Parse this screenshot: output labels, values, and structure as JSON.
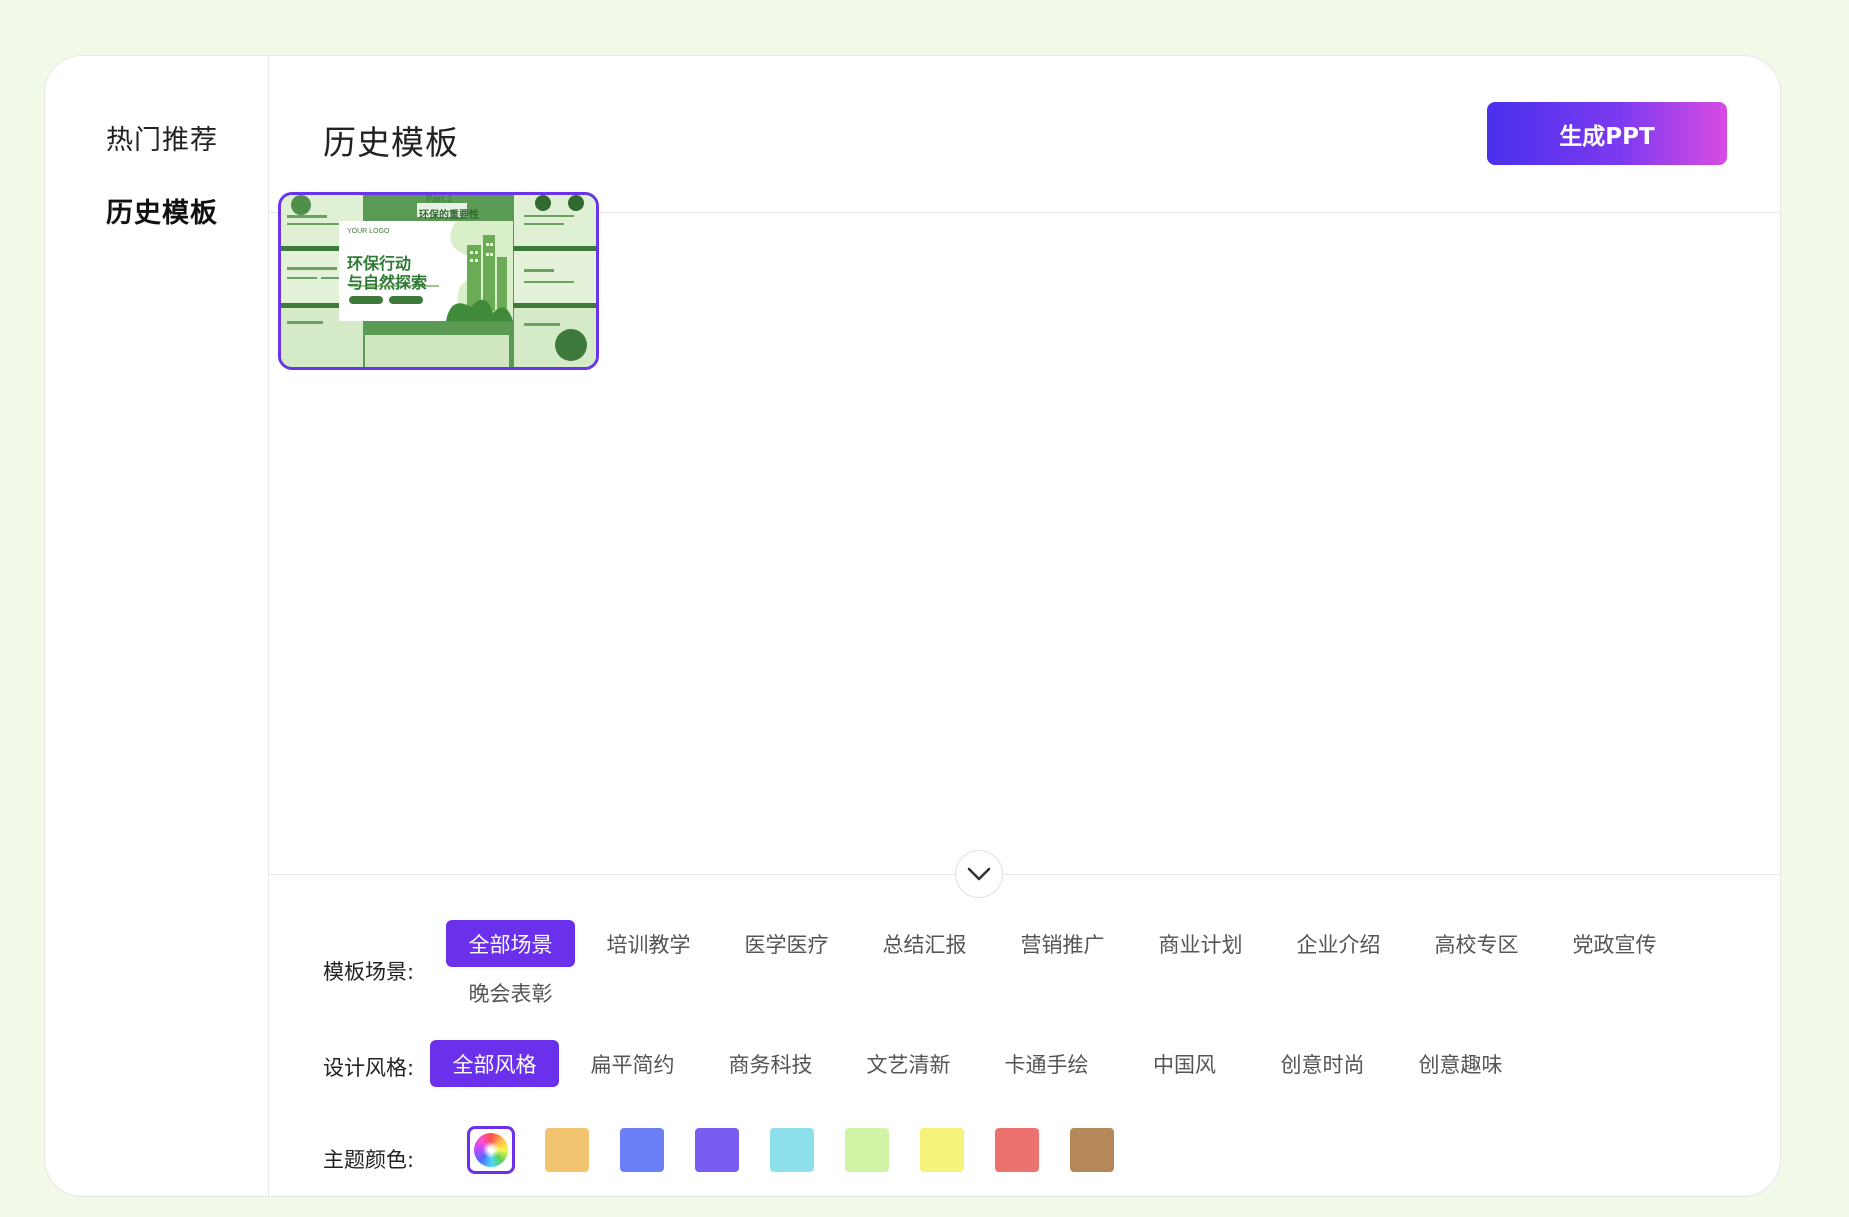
{
  "sidebar": {
    "items": [
      {
        "label": "热门推荐",
        "active": false
      },
      {
        "label": "历史模板",
        "active": true
      }
    ]
  },
  "header": {
    "title": "历史模板",
    "generate_button": "生成PPT"
  },
  "thumbnail": {
    "part_label": "Part 1",
    "section_title": "环保的重要性",
    "logo_text": "YOUR LOGO",
    "title_line1": "环保行动",
    "title_line2": "与自然探索"
  },
  "filters": {
    "scene": {
      "label": "模板场景:",
      "options": [
        "全部场景",
        "培训教学",
        "医学医疗",
        "总结汇报",
        "营销推广",
        "商业计划",
        "企业介绍",
        "高校专区",
        "党政宣传",
        "晚会表彰"
      ],
      "selected": "全部场景"
    },
    "style": {
      "label": "设计风格:",
      "options": [
        "全部风格",
        "扁平简约",
        "商务科技",
        "文艺清新",
        "卡通手绘",
        "中国风",
        "创意时尚",
        "创意趣味"
      ],
      "selected": "全部风格"
    },
    "color": {
      "label": "主题颜色:",
      "selected": "all",
      "swatches": [
        "#f2c46f",
        "#6c80f6",
        "#7a5cf0",
        "#8ee0ea",
        "#cff4a6",
        "#f6f37c",
        "#ec7270",
        "#b5885a"
      ]
    }
  },
  "colors": {
    "accent": "#6a30ec",
    "background": "#f1f9e8"
  }
}
